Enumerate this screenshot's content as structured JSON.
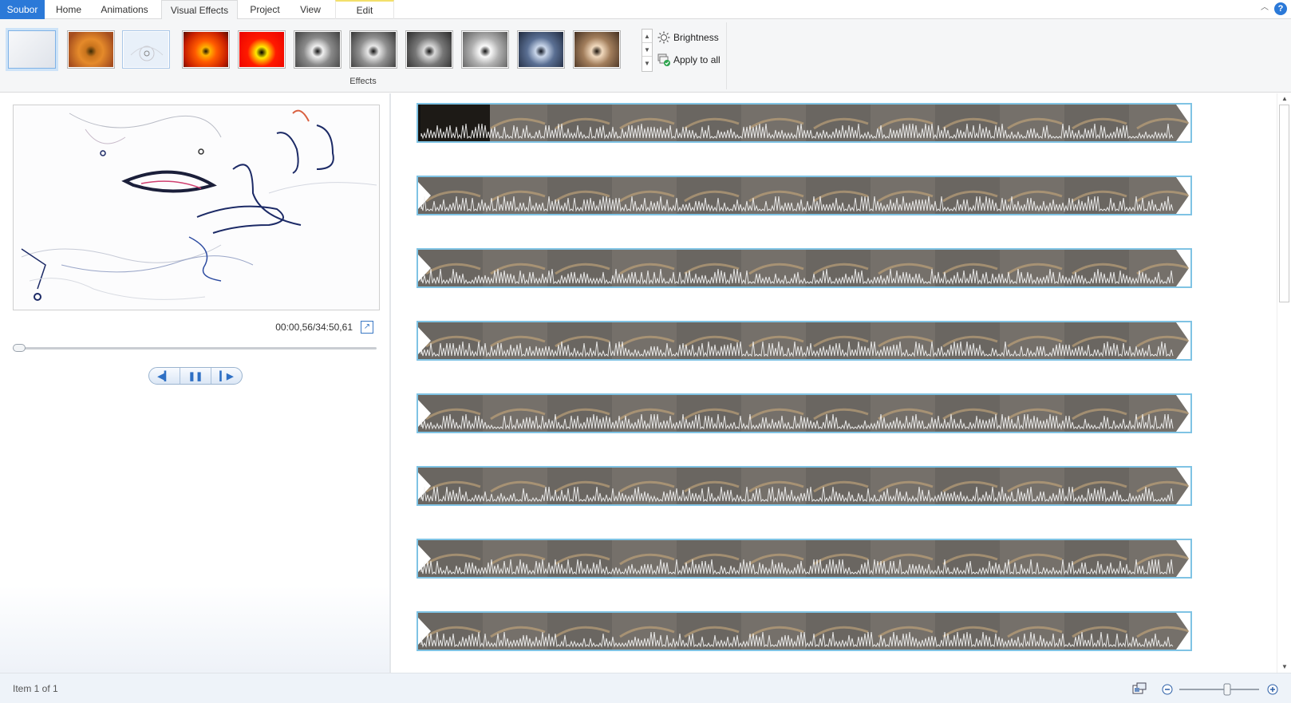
{
  "tabs": [
    {
      "label": "Soubor",
      "type": "file"
    },
    {
      "label": "Home"
    },
    {
      "label": "Animations"
    },
    {
      "label": "Visual Effects",
      "active": true
    },
    {
      "label": "Project"
    },
    {
      "label": "View"
    },
    {
      "label": "Edit",
      "contextual": true
    }
  ],
  "ribbon": {
    "effects_group_label": "Effects",
    "brightness_label": "Brightness",
    "apply_all_label": "Apply to all",
    "effects": [
      "No effect",
      "Warm",
      "Edge detection",
      "Posterize",
      "Threshold",
      "Black and white",
      "Black and white - red",
      "Black and white - yellow",
      "Black and white - orange",
      "Cyan tone",
      "Sepia tone"
    ],
    "selected_effect_index": 2
  },
  "preview": {
    "time_display": "00:00,56/34:50,61",
    "seek_position": 0.0
  },
  "status": {
    "item_text": "Item 1 of 1",
    "zoom_level": 0.6
  },
  "colors": {
    "file_tab": "#2b79d8",
    "clip_border": "#7fc3e4",
    "contextual_tab_accent": "#f3e06b"
  },
  "storyboard": {
    "clip_rows": 8
  }
}
